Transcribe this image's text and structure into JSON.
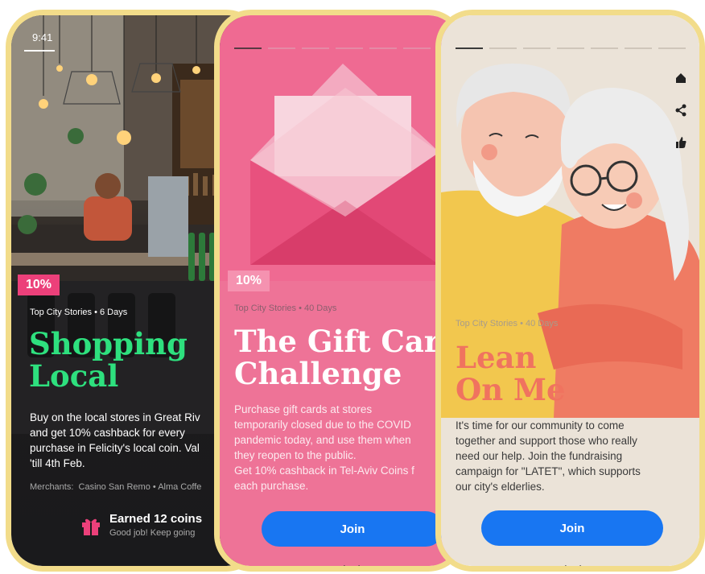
{
  "colors": {
    "frame": "#f2dc8a",
    "pink": "#ec407a",
    "green_title": "#2ee07e",
    "join_blue": "#1876f2",
    "coral_title": "#f0735f"
  },
  "phone1": {
    "time": "9:41",
    "discount": "10%",
    "category": "Top City Stories",
    "duration": "6 Days",
    "title_line1": "Shopping",
    "title_line2": "Local",
    "description": "Buy on the local stores in Great Riv\nand get 10% cashback for every\npurchase in Felicity's local coin. Val\n'till 4th Feb.",
    "merchants_label": "Merchants:",
    "merchant_1": "Casino San Remo",
    "merchant_2": "Alma Coffe",
    "earned_title": "Earned 12 coins",
    "earned_sub": "Good job! Keep going",
    "icon": "gift-icon"
  },
  "phone2": {
    "discount": "10%",
    "category": "Top City Stories",
    "duration": "40 Days",
    "title_line1": "The Gift Card",
    "title_line2": "Challenge",
    "description": "Purchase gift cards at stores\ntemporarily closed due to the COVID\npandemic today, and use them when\nthey reopen to the public.\nGet 10% cashback in Tel-Aviv Coins f\neach purchase.",
    "join_label": "Join",
    "progress_segments": 7,
    "active_segment": 1
  },
  "phone3": {
    "category": "Top City Stories",
    "duration": "40 Days",
    "title_line1": "Lean",
    "title_line2": "On Me",
    "description": "It's time for our community to come\ntogether and support those who really\nneed our help. Join the fundraising\ncampaign for \"LATET\", which supports\nour city's elderlies.",
    "join_label": "Join",
    "progress_segments": 7,
    "active_segment": 1,
    "side_icons": [
      "home-icon",
      "share-icon",
      "like-icon"
    ]
  }
}
